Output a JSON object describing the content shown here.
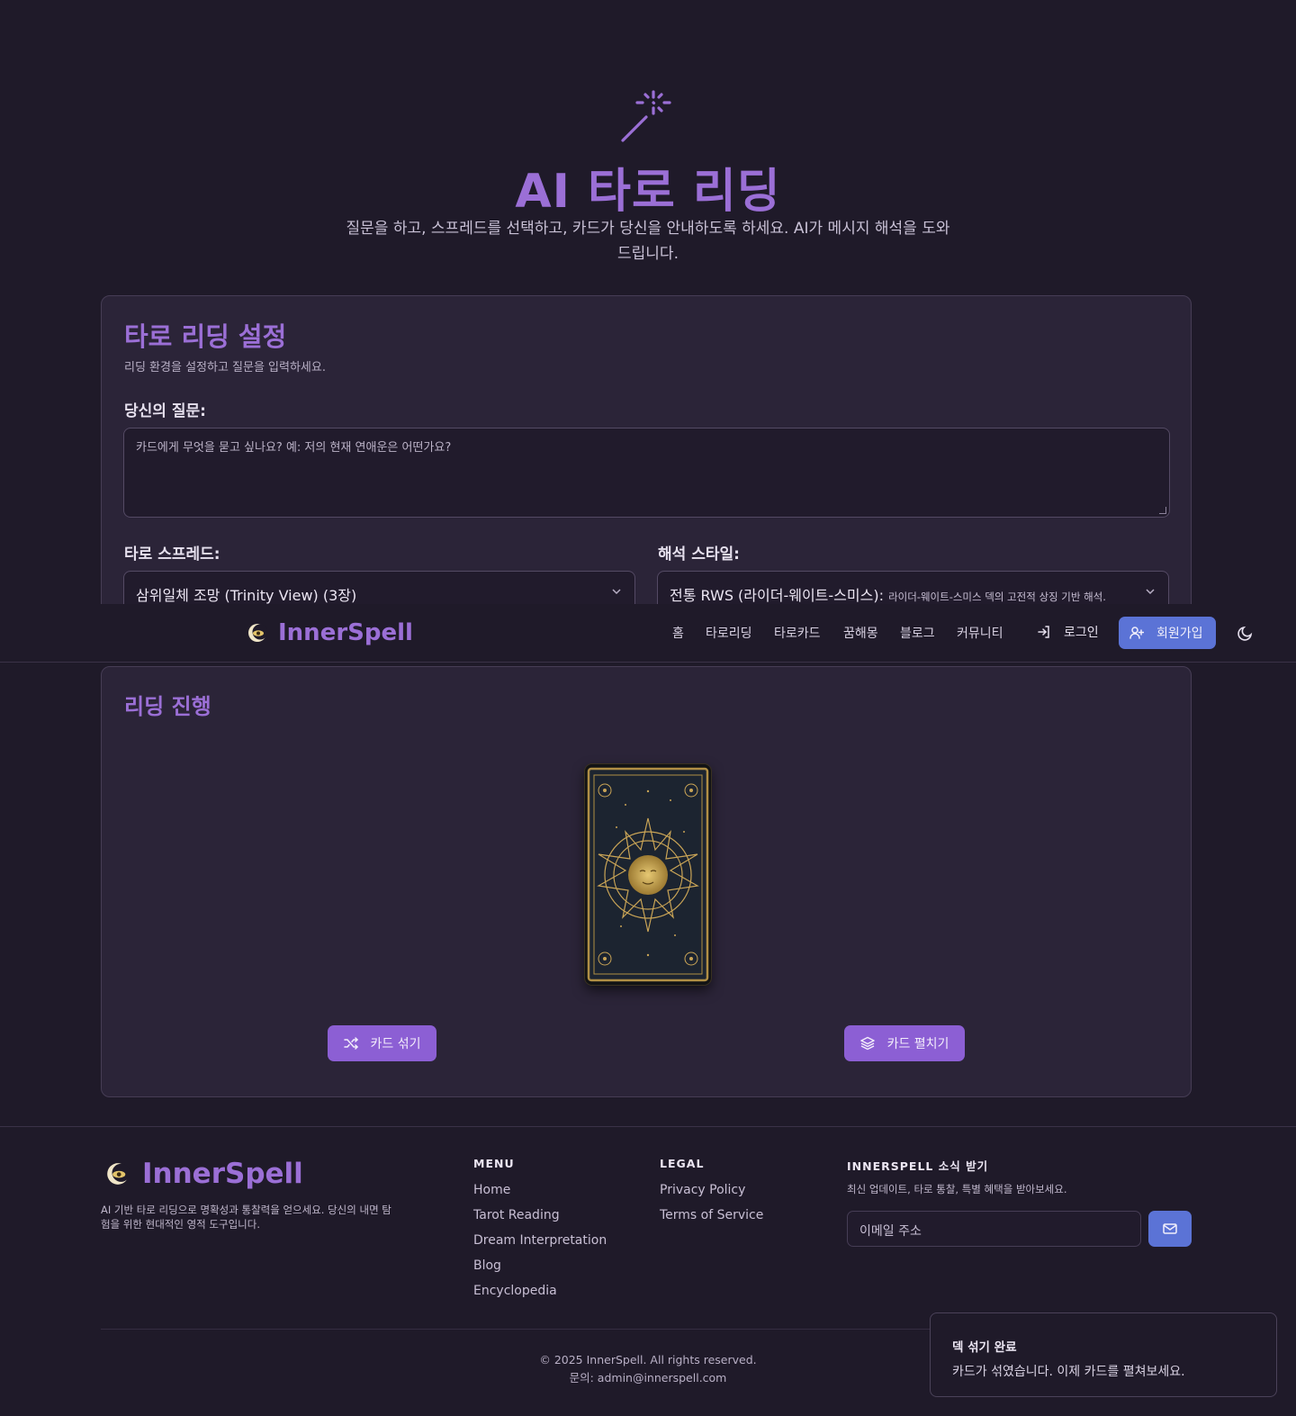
{
  "hero": {
    "title": "AI 타로 리딩",
    "subtitle": "질문을 하고, 스프레드를 선택하고, 카드가 당신을 안내하도록 하세요. AI가 메시지 해석을 도와드립니다."
  },
  "settings": {
    "title": "타로 리딩 설정",
    "description": "리딩 환경을 설정하고 질문을 입력하세요.",
    "question_label": "당신의 질문:",
    "question_placeholder": "카드에게 무엇을 묻고 싶나요? 예: 저의 현재 연애운은 어떤가요?",
    "spread_label": "타로 스프레드:",
    "spread_value": "삼위일체 조망 (Trinity View) (3장)",
    "style_label": "해석 스타일:",
    "style_value": "전통 RWS (라이더-웨이트-스미스):",
    "style_value_desc": "라이더-웨이트-스미스 덱의 고전적 상징 기반 해석."
  },
  "header": {
    "logo": "InnerSpell",
    "nav": [
      "홈",
      "타로리딩",
      "타로카드",
      "꿈해몽",
      "블로그",
      "커뮤니티"
    ],
    "login": "로그인",
    "signup": "회원가입"
  },
  "reading": {
    "title": "리딩 진행",
    "shuffle_label": "카드 섞기",
    "spread_label": "카드 펼치기"
  },
  "footer": {
    "logo": "InnerSpell",
    "description": "AI 기반 타로 리딩으로 명확성과 통찰력을 얻으세요. 당신의 내면 탐험을 위한 현대적인 영적 도구입니다.",
    "menu_title": "MENU",
    "menu_links": [
      "Home",
      "Tarot Reading",
      "Dream Interpretation",
      "Blog",
      "Encyclopedia"
    ],
    "legal_title": "LEGAL",
    "legal_links": [
      "Privacy Policy",
      "Terms of Service"
    ],
    "news_title": "INNERSPELL 소식 받기",
    "news_desc": "최신 업데이트, 타로 통찰, 특별 혜택을 받아보세요.",
    "email_placeholder": "이메일 주소",
    "copyright": "© 2025 InnerSpell. All rights reserved.",
    "contact": "문의: admin@innerspell.com"
  },
  "toast": {
    "title": "덱 섞기 완료",
    "message": "카드가 섞였습니다. 이제 카드를 펼쳐보세요."
  },
  "colors": {
    "accent": "#9b6fd6",
    "primary_button": "#5b73d6",
    "action_button": "#8c5fd4",
    "background": "#1f1a29"
  },
  "icons": [
    "magic-wand-icon",
    "eye-moon-logo-icon",
    "login-icon",
    "user-plus-icon",
    "moon-icon",
    "shuffle-icon",
    "layers-icon",
    "mail-icon",
    "chevron-down-icon"
  ]
}
